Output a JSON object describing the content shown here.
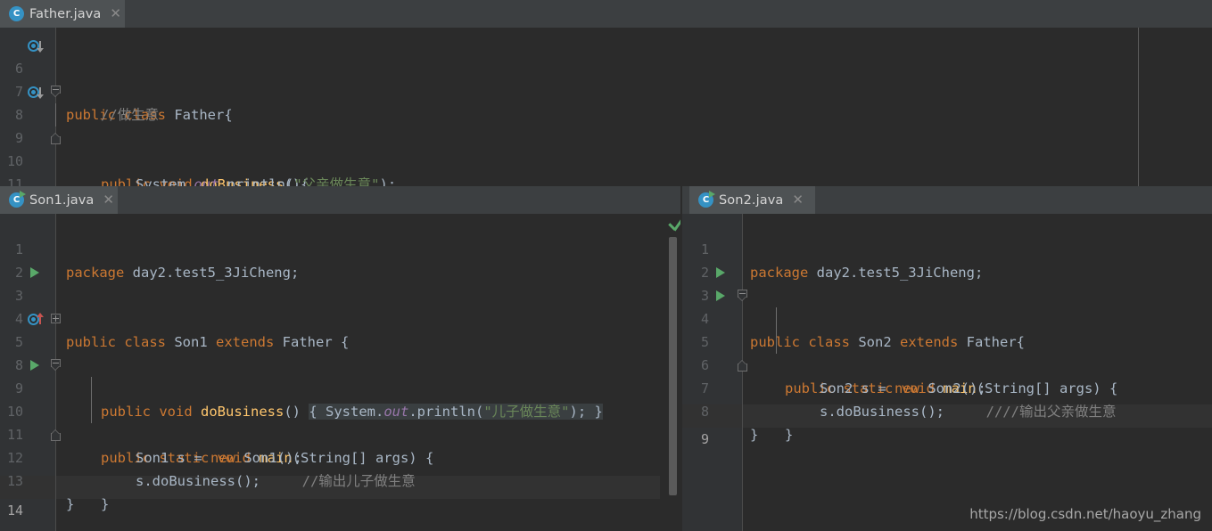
{
  "app": {
    "theme_bg": "#2b2b2b",
    "gutter_bg": "#313335",
    "tabbar_bg": "#3c3f41",
    "tab_active_bg": "#4e5254",
    "accent_blue": "#3592c4",
    "accent_green": "#59a869",
    "accent_red": "#c75450"
  },
  "watermark": "https://blog.csdn.net/haoyu_zhang",
  "panes": {
    "top": {
      "tab": {
        "label": "Father.java",
        "icon": "class-icon",
        "close_label": "✕"
      },
      "lines": [
        {
          "num": "6",
          "gutter": [
            "override-down-icon"
          ],
          "fold": "none",
          "tokens": [
            {
              "t": "public ",
              "c": "kw"
            },
            {
              "t": "class ",
              "c": "kw"
            },
            {
              "t": "Father",
              "c": "cls"
            },
            {
              "t": "{",
              "c": "pln"
            }
          ],
          "indent": 0
        },
        {
          "num": "7",
          "gutter": [],
          "fold": "none",
          "tokens": [
            {
              "t": "//做生意",
              "c": "cmt"
            }
          ],
          "indent": 1
        },
        {
          "num": "8",
          "gutter": [
            "override-down-icon"
          ],
          "fold": "fold-top",
          "tokens": [
            {
              "t": "public ",
              "c": "kw"
            },
            {
              "t": "void ",
              "c": "kw"
            },
            {
              "t": "doBusiness",
              "c": "mth"
            },
            {
              "t": "(){",
              "c": "pln"
            }
          ],
          "indent": 1
        },
        {
          "num": "9",
          "gutter": [],
          "fold": "line",
          "tokens": [
            {
              "t": "System.",
              "c": "pln"
            },
            {
              "t": "out",
              "c": "fld"
            },
            {
              "t": ".println(",
              "c": "pln"
            },
            {
              "t": "\"父亲做生意\"",
              "c": "str"
            },
            {
              "t": ");",
              "c": "pln"
            }
          ],
          "indent": 2
        },
        {
          "num": "10",
          "gutter": [],
          "fold": "fold-bottom",
          "tokens": [
            {
              "t": "}",
              "c": "pln"
            }
          ],
          "indent": 1
        },
        {
          "num": "11",
          "gutter": [],
          "fold": "none",
          "tokens": [
            {
              "t": "}",
              "c": "pln"
            }
          ],
          "indent": 0
        }
      ]
    },
    "left": {
      "tab": {
        "label": "Son1.java",
        "icon": "runnable-class-icon",
        "close_label": "✕"
      },
      "status": "inspection-ok",
      "lines": [
        {
          "num": "1",
          "gutter": [],
          "fold": "none",
          "tokens": [
            {
              "t": "package ",
              "c": "kw"
            },
            {
              "t": "day2.test5_3JiCheng;",
              "c": "pln"
            }
          ],
          "indent": 0
        },
        {
          "num": "2",
          "gutter": [],
          "fold": "none",
          "tokens": [],
          "indent": 0
        },
        {
          "num": "3",
          "gutter": [
            "run-icon"
          ],
          "fold": "none",
          "tokens": [
            {
              "t": "public ",
              "c": "kw"
            },
            {
              "t": "class ",
              "c": "kw"
            },
            {
              "t": "Son1 ",
              "c": "cls"
            },
            {
              "t": "extends ",
              "c": "kw"
            },
            {
              "t": "Father ",
              "c": "cls"
            },
            {
              "t": "{",
              "c": "pln"
            }
          ],
          "indent": 0
        },
        {
          "num": "4",
          "gutter": [],
          "fold": "none",
          "tokens": [],
          "indent": 0
        },
        {
          "num": "5",
          "gutter": [
            "override-up-icon"
          ],
          "fold": "fold-collapsed",
          "tokens": [
            {
              "t": "public ",
              "c": "kw"
            },
            {
              "t": "void ",
              "c": "kw"
            },
            {
              "t": "doBusiness",
              "c": "mth"
            },
            {
              "t": "() ",
              "c": "pln"
            },
            {
              "t": "{ ",
              "c": "folded-brace"
            },
            {
              "t": "System.",
              "c": "folded-pln"
            },
            {
              "t": "out",
              "c": "folded-fld"
            },
            {
              "t": ".println(",
              "c": "folded-pln"
            },
            {
              "t": "\"儿子做生意\"",
              "c": "folded-str"
            },
            {
              "t": "); ",
              "c": "folded-pln"
            },
            {
              "t": "}",
              "c": "folded-brace"
            }
          ],
          "indent": 1
        },
        {
          "num": "8",
          "gutter": [],
          "fold": "none",
          "tokens": [],
          "indent": 0
        },
        {
          "num": "9",
          "gutter": [
            "run-icon"
          ],
          "fold": "fold-top",
          "tokens": [
            {
              "t": "public ",
              "c": "kw"
            },
            {
              "t": "static ",
              "c": "kw"
            },
            {
              "t": "void ",
              "c": "kw"
            },
            {
              "t": "main",
              "c": "mth"
            },
            {
              "t": "(String[] args) {",
              "c": "pln"
            }
          ],
          "indent": 1
        },
        {
          "num": "10",
          "gutter": [],
          "fold": "line",
          "tokens": [
            {
              "t": "Son1 s = ",
              "c": "pln"
            },
            {
              "t": "new ",
              "c": "kw"
            },
            {
              "t": "Son1();",
              "c": "pln"
            }
          ],
          "indent": 2
        },
        {
          "num": "11",
          "gutter": [],
          "fold": "line",
          "tokens": [
            {
              "t": "s.doBusiness();     ",
              "c": "pln"
            },
            {
              "t": "//输出儿子做生意",
              "c": "cmt"
            }
          ],
          "indent": 2
        },
        {
          "num": "12",
          "gutter": [],
          "fold": "fold-bottom",
          "tokens": [
            {
              "t": "}",
              "c": "pln"
            }
          ],
          "indent": 1
        },
        {
          "num": "13",
          "gutter": [],
          "fold": "none",
          "tokens": [
            {
              "t": "}",
              "c": "pln"
            }
          ],
          "indent": 0
        },
        {
          "num": "14",
          "gutter": [],
          "fold": "none",
          "tokens": [],
          "indent": 0,
          "current": true
        }
      ]
    },
    "right": {
      "tab": {
        "label": "Son2.java",
        "icon": "runnable-class-icon",
        "close_label": "✕"
      },
      "lines": [
        {
          "num": "1",
          "gutter": [],
          "fold": "none",
          "tokens": [
            {
              "t": "package ",
              "c": "kw"
            },
            {
              "t": "day2.test5_3JiCheng;",
              "c": "pln"
            }
          ],
          "indent": 0
        },
        {
          "num": "2",
          "gutter": [],
          "fold": "none",
          "tokens": [],
          "indent": 0
        },
        {
          "num": "3",
          "gutter": [
            "run-icon"
          ],
          "fold": "none",
          "tokens": [
            {
              "t": "public ",
              "c": "kw"
            },
            {
              "t": "class ",
              "c": "kw"
            },
            {
              "t": "Son2 ",
              "c": "cls"
            },
            {
              "t": "extends ",
              "c": "kw"
            },
            {
              "t": "Father",
              "c": "cls"
            },
            {
              "t": "{",
              "c": "pln"
            }
          ],
          "indent": 0
        },
        {
          "num": "4",
          "gutter": [
            "run-icon"
          ],
          "fold": "fold-top",
          "tokens": [
            {
              "t": "public ",
              "c": "kw"
            },
            {
              "t": "static ",
              "c": "kw"
            },
            {
              "t": "void ",
              "c": "kw"
            },
            {
              "t": "main",
              "c": "mth"
            },
            {
              "t": "(String[] args) {",
              "c": "pln"
            }
          ],
          "indent": 1
        },
        {
          "num": "5",
          "gutter": [],
          "fold": "line",
          "tokens": [
            {
              "t": "Son2 s = ",
              "c": "pln"
            },
            {
              "t": "new ",
              "c": "kw"
            },
            {
              "t": "Son2();",
              "c": "pln"
            }
          ],
          "indent": 2
        },
        {
          "num": "6",
          "gutter": [],
          "fold": "line",
          "tokens": [
            {
              "t": "s.doBusiness();     ",
              "c": "pln"
            },
            {
              "t": "////输出父亲做生意",
              "c": "cmt"
            }
          ],
          "indent": 2
        },
        {
          "num": "7",
          "gutter": [],
          "fold": "fold-bottom",
          "tokens": [
            {
              "t": "}",
              "c": "pln"
            }
          ],
          "indent": 1
        },
        {
          "num": "8",
          "gutter": [],
          "fold": "none",
          "tokens": [
            {
              "t": "}",
              "c": "pln"
            }
          ],
          "indent": 0
        },
        {
          "num": "9",
          "gutter": [],
          "fold": "none",
          "tokens": [],
          "indent": 0,
          "current": true
        }
      ]
    }
  }
}
